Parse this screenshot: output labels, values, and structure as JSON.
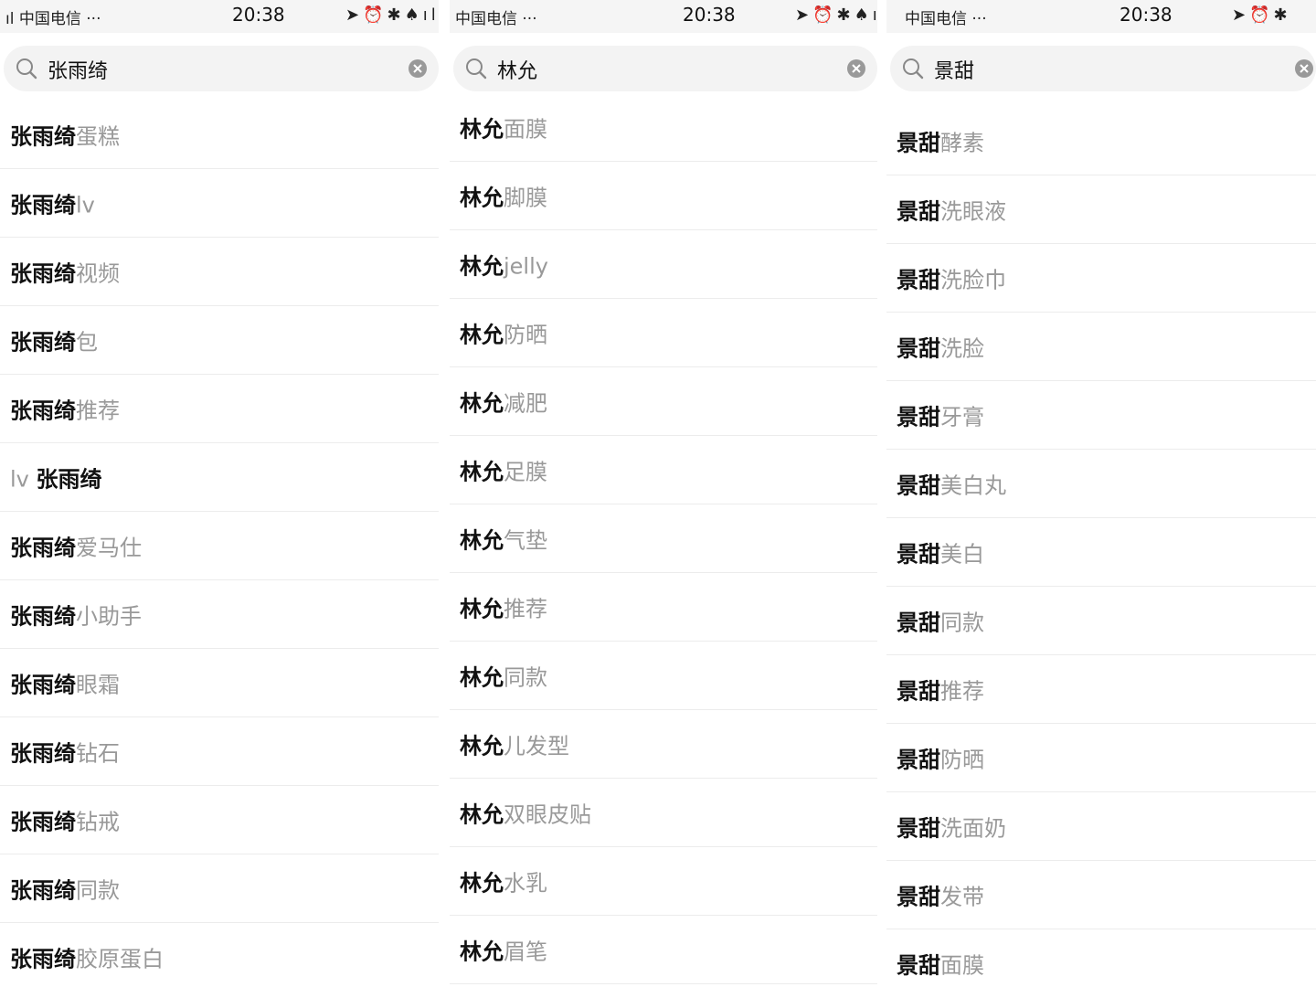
{
  "panels": [
    {
      "status": {
        "carrier": "中国电信",
        "dots": "···",
        "time": "20:38"
      },
      "search": {
        "query": "张雨绮"
      },
      "items": [
        {
          "pre": "",
          "kw": "张雨绮",
          "suf": "蛋糕"
        },
        {
          "pre": "",
          "kw": "张雨绮",
          "suf": "lv"
        },
        {
          "pre": "",
          "kw": "张雨绮",
          "suf": "视频"
        },
        {
          "pre": "",
          "kw": "张雨绮",
          "suf": "包"
        },
        {
          "pre": "",
          "kw": "张雨绮",
          "suf": "推荐"
        },
        {
          "pre": "lv ",
          "kw": "张雨绮",
          "suf": ""
        },
        {
          "pre": "",
          "kw": "张雨绮",
          "suf": "爱马仕"
        },
        {
          "pre": "",
          "kw": "张雨绮",
          "suf": "小助手"
        },
        {
          "pre": "",
          "kw": "张雨绮",
          "suf": "眼霜"
        },
        {
          "pre": "",
          "kw": "张雨绮",
          "suf": "钻石"
        },
        {
          "pre": "",
          "kw": "张雨绮",
          "suf": "钻戒"
        },
        {
          "pre": "",
          "kw": "张雨绮",
          "suf": "同款"
        },
        {
          "pre": "",
          "kw": "张雨绮",
          "suf": "胶原蛋白"
        }
      ]
    },
    {
      "status": {
        "carrier": "中国电信",
        "dots": "···",
        "time": "20:38"
      },
      "search": {
        "query": "林允"
      },
      "items": [
        {
          "pre": "",
          "kw": "林允",
          "suf": "面膜"
        },
        {
          "pre": "",
          "kw": "林允",
          "suf": "脚膜"
        },
        {
          "pre": "",
          "kw": "林允",
          "suf": "jelly"
        },
        {
          "pre": "",
          "kw": "林允",
          "suf": "防晒"
        },
        {
          "pre": "",
          "kw": "林允",
          "suf": "减肥"
        },
        {
          "pre": "",
          "kw": "林允",
          "suf": "足膜"
        },
        {
          "pre": "",
          "kw": "林允",
          "suf": "气垫"
        },
        {
          "pre": "",
          "kw": "林允",
          "suf": "推荐"
        },
        {
          "pre": "",
          "kw": "林允",
          "suf": "同款"
        },
        {
          "pre": "",
          "kw": "林允",
          "suf": "儿发型"
        },
        {
          "pre": "",
          "kw": "林允",
          "suf": "双眼皮贴"
        },
        {
          "pre": "",
          "kw": "林允",
          "suf": "水乳"
        },
        {
          "pre": "",
          "kw": "林允",
          "suf": "眉笔"
        }
      ]
    },
    {
      "status": {
        "carrier": "中国电信",
        "dots": "···",
        "time": "20:38"
      },
      "search": {
        "query": "景甜"
      },
      "items": [
        {
          "pre": "",
          "kw": "景甜",
          "suf": "酵素"
        },
        {
          "pre": "",
          "kw": "景甜",
          "suf": "洗眼液"
        },
        {
          "pre": "",
          "kw": "景甜",
          "suf": "洗脸巾"
        },
        {
          "pre": "",
          "kw": "景甜",
          "suf": "洗脸"
        },
        {
          "pre": "",
          "kw": "景甜",
          "suf": "牙膏"
        },
        {
          "pre": "",
          "kw": "景甜",
          "suf": "美白丸"
        },
        {
          "pre": "",
          "kw": "景甜",
          "suf": "美白"
        },
        {
          "pre": "",
          "kw": "景甜",
          "suf": "同款"
        },
        {
          "pre": "",
          "kw": "景甜",
          "suf": "推荐"
        },
        {
          "pre": "",
          "kw": "景甜",
          "suf": "防晒"
        },
        {
          "pre": "",
          "kw": "景甜",
          "suf": "洗面奶"
        },
        {
          "pre": "",
          "kw": "景甜",
          "suf": "发带"
        },
        {
          "pre": "",
          "kw": "景甜",
          "suf": "面膜"
        }
      ]
    }
  ]
}
